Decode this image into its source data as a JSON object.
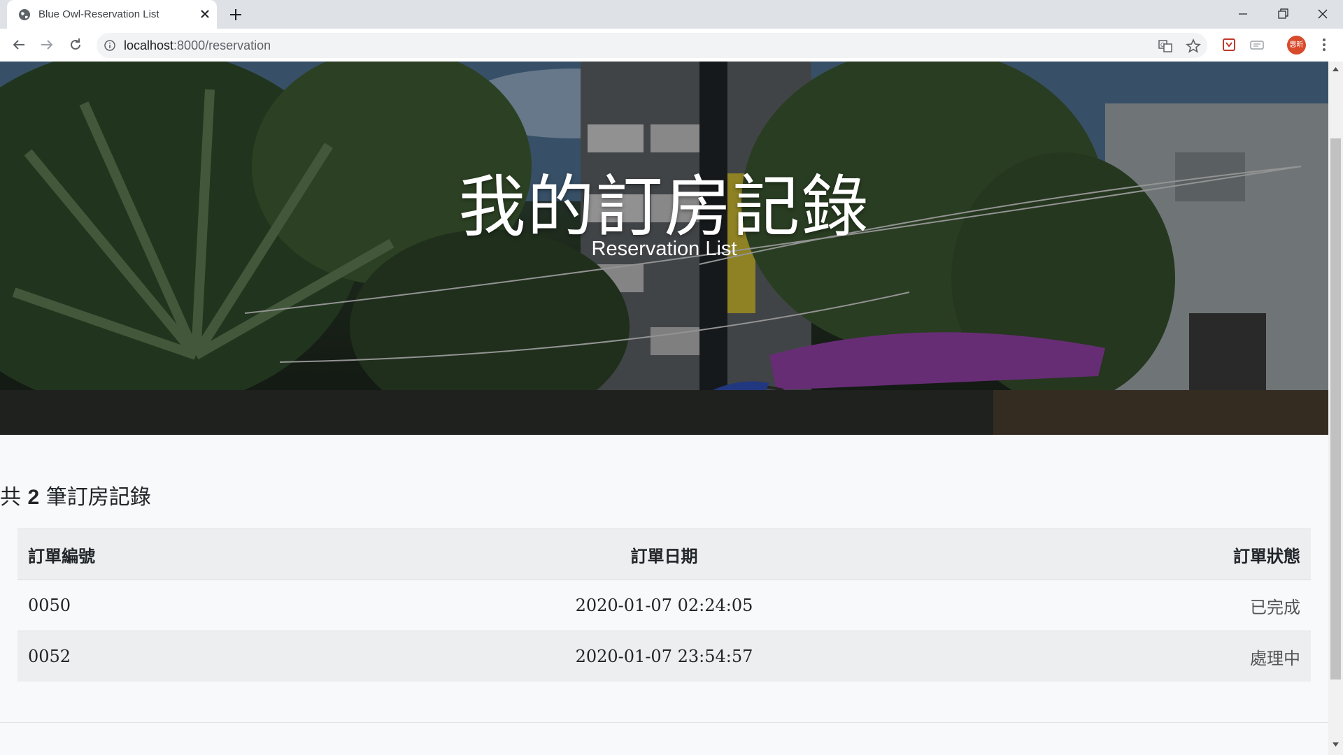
{
  "browser": {
    "tab_title": "Blue Owl-Reservation List",
    "url_host": "localhost",
    "url_path": ":8000/reservation",
    "avatar_text": "惠昕"
  },
  "hero": {
    "title": "我的訂房記錄",
    "subtitle": "Reservation List"
  },
  "summary": {
    "prefix": "共 ",
    "count": "2",
    "suffix": " 筆訂房記錄"
  },
  "table": {
    "headers": [
      "訂單編號",
      "訂單日期",
      "訂單狀態"
    ],
    "rows": [
      {
        "id": "0050",
        "date": "2020-01-07 02:24:05",
        "status": "已完成"
      },
      {
        "id": "0052",
        "date": "2020-01-07 23:54:57",
        "status": "處理中"
      }
    ]
  },
  "icons": [
    "globe-icon",
    "close-icon",
    "plus-icon",
    "minimize-icon",
    "restore-icon",
    "back-icon",
    "forward-icon",
    "reload-icon",
    "info-icon",
    "translate-icon",
    "star-icon",
    "extension-icon",
    "menu-icon"
  ],
  "colors": {
    "tab_strip": "#dee1e6",
    "avatar": "#d94a2b",
    "umbrella": "#8e3fa3"
  }
}
